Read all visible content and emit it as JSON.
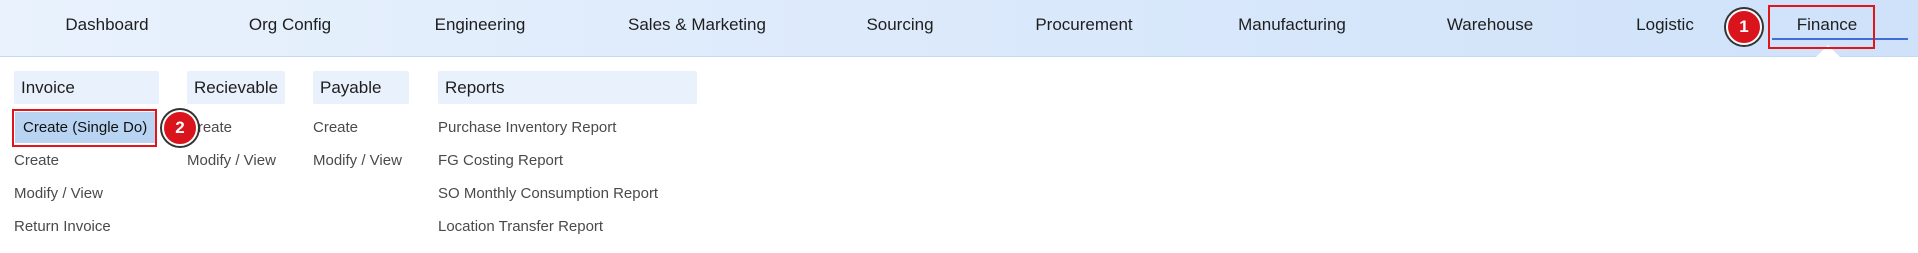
{
  "topnav": {
    "items": [
      {
        "label": "Dashboard"
      },
      {
        "label": "Org Config"
      },
      {
        "label": "Engineering"
      },
      {
        "label": "Sales & Marketing"
      },
      {
        "label": "Sourcing"
      },
      {
        "label": "Procurement"
      },
      {
        "label": "Manufacturing"
      },
      {
        "label": "Warehouse"
      },
      {
        "label": "Logistic"
      },
      {
        "label": "Finance"
      }
    ],
    "active": "Finance"
  },
  "markers": {
    "one": "1",
    "two": "2"
  },
  "menu": {
    "invoice": {
      "header": "Invoice",
      "items": [
        "Create (Single Do)",
        "Create",
        "Modify / View",
        "Return Invoice"
      ]
    },
    "receivable": {
      "header": "Recievable",
      "items": [
        "Create",
        "Modify / View"
      ]
    },
    "payable": {
      "header": "Payable",
      "items": [
        "Create",
        "Modify / View"
      ]
    },
    "reports": {
      "header": "Reports",
      "items": [
        "Purchase Inventory Report",
        "FG Costing Report",
        "SO Monthly Consumption Report",
        "Location Transfer Report"
      ]
    }
  },
  "colors": {
    "accent": "#3f6fd6",
    "highlight": "#e0161b",
    "selected_bg": "#b9d4f2",
    "header_bg": "#e8f1fc"
  }
}
